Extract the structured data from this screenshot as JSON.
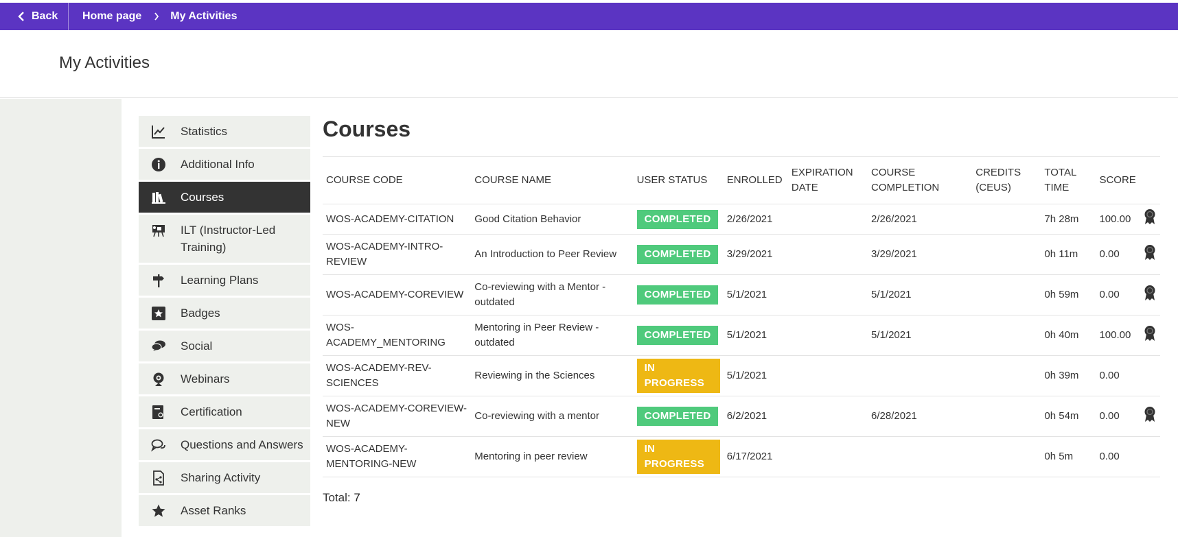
{
  "topbar": {
    "back_label": "Back",
    "breadcrumb": [
      "Home page",
      "My Activities"
    ]
  },
  "page": {
    "title": "My Activities"
  },
  "sidebar": {
    "items": [
      {
        "label": "Statistics",
        "icon": "chart-line-icon",
        "active": false
      },
      {
        "label": "Additional Info",
        "icon": "info-icon",
        "active": false
      },
      {
        "label": "Courses",
        "icon": "books-icon",
        "active": true
      },
      {
        "label": "ILT (Instructor-Led Training)",
        "icon": "presentation-icon",
        "active": false
      },
      {
        "label": "Learning Plans",
        "icon": "signpost-icon",
        "active": false
      },
      {
        "label": "Badges",
        "icon": "star-badge-icon",
        "active": false
      },
      {
        "label": "Social",
        "icon": "chat-bubbles-icon",
        "active": false
      },
      {
        "label": "Webinars",
        "icon": "webcam-icon",
        "active": false
      },
      {
        "label": "Certification",
        "icon": "certificate-icon",
        "active": false
      },
      {
        "label": "Questions and Answers",
        "icon": "speech-bubbles-icon",
        "active": false
      },
      {
        "label": "Sharing Activity",
        "icon": "share-document-icon",
        "active": false
      },
      {
        "label": "Asset Ranks",
        "icon": "star-icon",
        "active": false
      }
    ]
  },
  "main": {
    "title": "Courses",
    "columns": [
      "Course Code",
      "Course Name",
      "User Status",
      "Enrolled",
      "Expiration Date",
      "Course Completion",
      "Credits (CEUs)",
      "Total Time",
      "Score"
    ],
    "rows": [
      {
        "code": "WOS-ACADEMY-CITATION",
        "name": "Good Citation Behavior",
        "status": "COMPLETED",
        "status_type": "completed",
        "enrolled": "2/26/2021",
        "expiration": "",
        "completion": "2/26/2021",
        "credits": "",
        "time": "7h 28m",
        "score": "100.00",
        "certificate": true
      },
      {
        "code": "WOS-ACADEMY-INTRO-REVIEW",
        "name": "An Introduction to Peer Review",
        "status": "COMPLETED",
        "status_type": "completed",
        "enrolled": "3/29/2021",
        "expiration": "",
        "completion": "3/29/2021",
        "credits": "",
        "time": "0h 11m",
        "score": "0.00",
        "certificate": true
      },
      {
        "code": "WOS-ACADEMY-COREVIEW",
        "name": "Co-reviewing with a Mentor - outdated",
        "status": "COMPLETED",
        "status_type": "completed",
        "enrolled": "5/1/2021",
        "expiration": "",
        "completion": "5/1/2021",
        "credits": "",
        "time": "0h 59m",
        "score": "0.00",
        "certificate": true
      },
      {
        "code": "WOS-ACADEMY_MENTORING",
        "name": "Mentoring in Peer Review - outdated",
        "status": "COMPLETED",
        "status_type": "completed",
        "enrolled": "5/1/2021",
        "expiration": "",
        "completion": "5/1/2021",
        "credits": "",
        "time": "0h 40m",
        "score": "100.00",
        "certificate": true
      },
      {
        "code": "WOS-ACADEMY-REV-SCIENCES",
        "name": "Reviewing in the Sciences",
        "status": "IN PROGRESS",
        "status_type": "inprogress",
        "enrolled": "5/1/2021",
        "expiration": "",
        "completion": "",
        "credits": "",
        "time": "0h 39m",
        "score": "0.00",
        "certificate": false
      },
      {
        "code": "WOS-ACADEMY-COREVIEW-NEW",
        "name": "Co-reviewing with a mentor",
        "status": "COMPLETED",
        "status_type": "completed",
        "enrolled": "6/2/2021",
        "expiration": "",
        "completion": "6/28/2021",
        "credits": "",
        "time": "0h 54m",
        "score": "0.00",
        "certificate": true
      },
      {
        "code": "WOS-ACADEMY-MENTORING-NEW",
        "name": "Mentoring in peer review",
        "status": "IN PROGRESS",
        "status_type": "inprogress",
        "enrolled": "6/17/2021",
        "expiration": "",
        "completion": "",
        "credits": "",
        "time": "0h 5m",
        "score": "0.00",
        "certificate": false
      }
    ],
    "total_label": "Total:",
    "total_value": "7"
  },
  "colors": {
    "topbar": "#5b34c2",
    "completed": "#4fca7c",
    "inprogress": "#eeb814",
    "sidebar_active": "#333333",
    "sidebar_bg": "#eef0ec"
  }
}
